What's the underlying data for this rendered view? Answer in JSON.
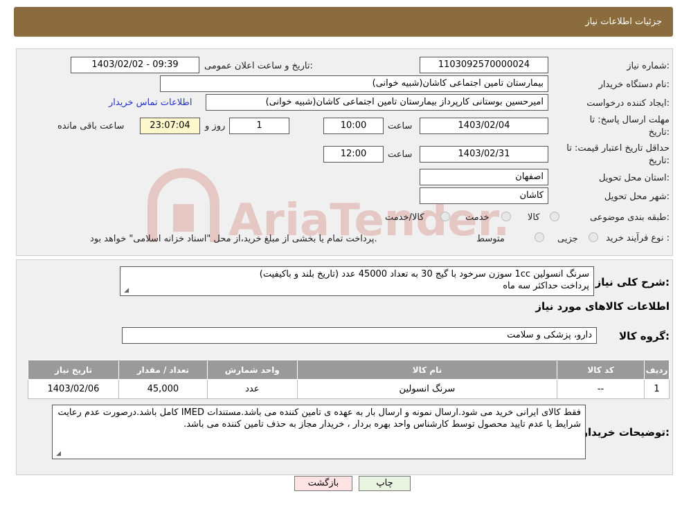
{
  "header": {
    "title": "جزئیات اطلاعات نیاز"
  },
  "fields": {
    "need_number_label": "شماره نیاز:",
    "need_number": "1103092570000024",
    "announce_label": "تاریخ و ساعت اعلان عمومی:",
    "announce_value": "1403/02/02 - 09:39",
    "buyer_org_label": "نام دستگاه خریدار:",
    "buyer_org": "بیمارستان تامین اجتماعی کاشان(شبیه خوانی)",
    "creator_label": "ایجاد کننده درخواست:",
    "creator": "امیرحسین بوستانی کارپرداز بیمارستان تامین اجتماعی کاشان(شبیه خوانی)",
    "contact_link": "اطلاعات تماس خریدار",
    "deadline_label_1": "مهلت ارسال پاسخ: تا",
    "deadline_label_2": "تاریخ:",
    "deadline_date": "1403/02/04",
    "time_label": "ساعت",
    "deadline_time": "10:00",
    "days_value": "1",
    "days_label": "روز و",
    "remaining_time": "23:07:04",
    "remaining_label": "ساعت باقی مانده",
    "validity_label_1": "حداقل تاریخ اعتبار قیمت: تا",
    "validity_label_2": "تاریخ:",
    "validity_date": "1403/02/31",
    "validity_time": "12:00",
    "province_label": "استان محل تحویل:",
    "province": "اصفهان",
    "city_label": "شهر محل تحویل:",
    "city": "کاشان",
    "category_label": "طبقه بندی موضوعی:",
    "category_options": [
      "کالا",
      "خدمت",
      "کالا/خدمت"
    ],
    "process_label": "نوع فرآیند خرید :",
    "process_options": [
      "جزیی",
      "متوسط"
    ],
    "process_note": "پرداخت تمام یا بخشی از مبلغ خرید،از محل \"اسناد خزانه اسلامی\" خواهد بود."
  },
  "description": {
    "label": "شرح کلی نیاز:",
    "line1": "سرنگ انسولین 1cc سوزن سرخود  با گیج 30 به تعداد 45000 عدد (تاریخ بلند و باکیفیت)",
    "line2": "پرداخت حداکثر سه ماه"
  },
  "goods": {
    "section_title": "اطلاعات کالاهای مورد نیاز",
    "group_label": "گروه کالا:",
    "group_value": "دارو، پزشکی و سلامت",
    "columns": [
      "ردیف",
      "کد کالا",
      "نام کالا",
      "واحد شمارش",
      "تعداد / مقدار",
      "تاریخ نیاز"
    ],
    "rows": [
      [
        "1",
        "--",
        "سرنگ انسولین",
        "عدد",
        "45,000",
        "1403/02/06"
      ]
    ]
  },
  "buyer_notes": {
    "label": "توضیحات خریدار:",
    "text": "فقط کالای ایرانی خرید می شود.ارسال نمونه و ارسال بار به عهده ی تامین کننده می باشد.مستندات IMED کامل باشد.درصورت عدم رعایت شرایط یا عدم تایید محصول توسط کارشناس واحد بهره بردار ، خریدار مجاز به حذف تامین کننده می باشد."
  },
  "buttons": {
    "print": "چاپ",
    "back": "بازگشت"
  },
  "watermark": {
    "text": "AriaTender.neT"
  },
  "colors": {
    "header_bg": "#8B6C3E",
    "table_header": "#9a9a9a",
    "back_button_bg": "#fde3e3",
    "print_button_bg": "#e9f5e0",
    "watermark": "#c0392b"
  }
}
